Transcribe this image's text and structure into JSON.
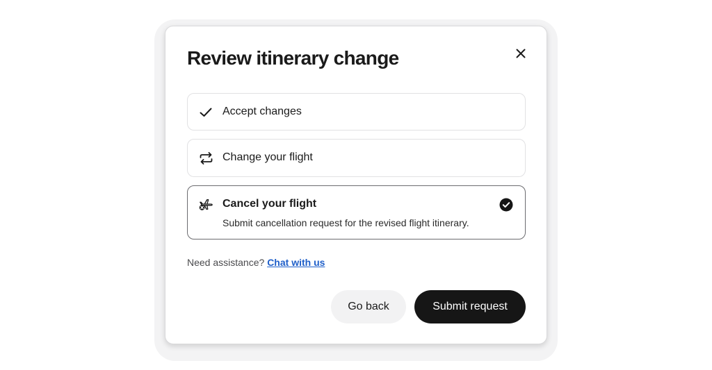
{
  "dialog": {
    "title": "Review itinerary change",
    "close_icon": "close-icon"
  },
  "options": [
    {
      "label": "Accept changes",
      "icon": "checkmark-icon",
      "selected": false
    },
    {
      "label": "Change your flight",
      "icon": "swap-arrows-icon",
      "selected": false
    },
    {
      "label": "Cancel your flight",
      "description": "Submit cancellation request for the revised flight itinerary.",
      "icon": "plane-cancel-icon",
      "selected": true
    }
  ],
  "assistance": {
    "prompt": "Need assistance?",
    "link_label": "Chat with us"
  },
  "buttons": {
    "back_label": "Go back",
    "submit_label": "Submit request"
  },
  "colors": {
    "primary_button": "#161616",
    "link": "#1f5fc9",
    "selected_border": "#6b6b6f"
  }
}
